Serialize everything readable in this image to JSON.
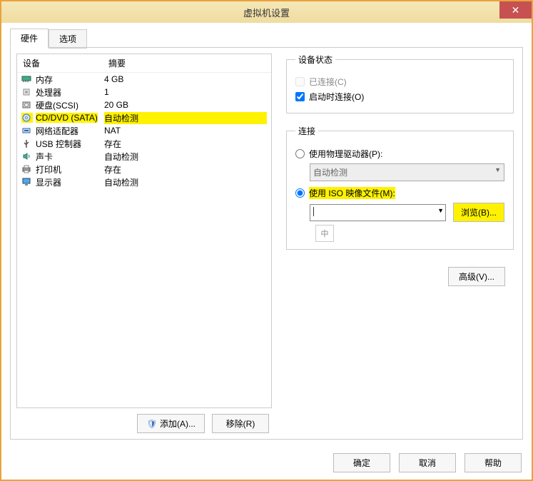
{
  "window": {
    "title": "虚拟机设置"
  },
  "tabs": {
    "hardware": "硬件",
    "options": "选项"
  },
  "list": {
    "hdr_device": "设备",
    "hdr_summary": "摘要",
    "rows": [
      {
        "name": "内存",
        "summary": "4 GB",
        "icon": "memory"
      },
      {
        "name": "处理器",
        "summary": "1",
        "icon": "cpu"
      },
      {
        "name": "硬盘(SCSI)",
        "summary": "20 GB",
        "icon": "disk"
      },
      {
        "name": "CD/DVD (SATA)",
        "summary": "自动检测",
        "icon": "cd",
        "sel": true
      },
      {
        "name": "网络适配器",
        "summary": "NAT",
        "icon": "net"
      },
      {
        "name": "USB 控制器",
        "summary": "存在",
        "icon": "usb"
      },
      {
        "name": "声卡",
        "summary": "自动检测",
        "icon": "sound"
      },
      {
        "name": "打印机",
        "summary": "存在",
        "icon": "printer"
      },
      {
        "name": "显示器",
        "summary": "自动检测",
        "icon": "display"
      }
    ]
  },
  "buttons": {
    "add": "添加(A)...",
    "remove": "移除(R)"
  },
  "status": {
    "legend": "设备状态",
    "connected": "已连接(C)",
    "connect_poweron": "启动时连接(O)"
  },
  "conn": {
    "legend": "连接",
    "physical": "使用物理驱动器(P):",
    "autodetect": "自动检测",
    "iso": "使用 ISO 映像文件(M):",
    "browse": "浏览(B)...",
    "ime": "中"
  },
  "advanced": "高级(V)...",
  "footer": {
    "ok": "确定",
    "cancel": "取消",
    "help": "帮助"
  }
}
